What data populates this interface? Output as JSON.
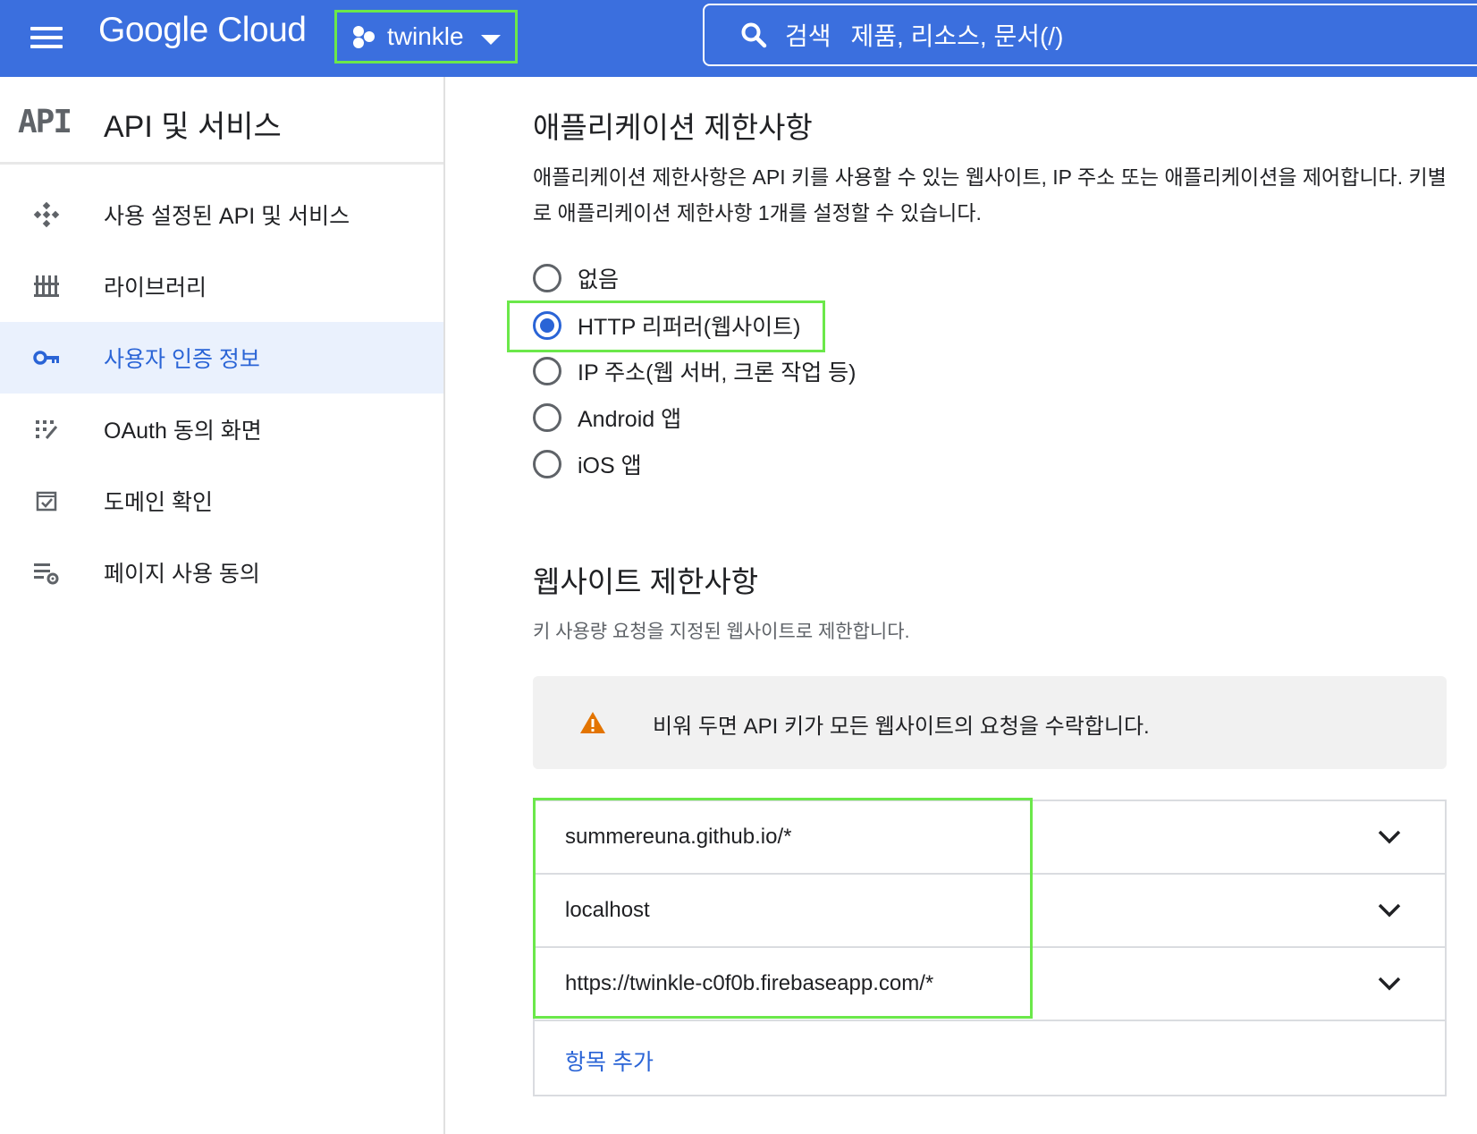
{
  "topbar": {
    "logo": "Google Cloud",
    "project": "twinkle",
    "search_label": "검색",
    "search_hint": "제품, 리소스, 문서(/)"
  },
  "sidebar": {
    "api_logo": "API",
    "title": "API 및 서비스",
    "items": [
      {
        "label": "사용 설정된 API 및 서비스",
        "icon": "api-hub-icon"
      },
      {
        "label": "라이브러리",
        "icon": "library-icon"
      },
      {
        "label": "사용자 인증 정보",
        "icon": "key-icon",
        "active": true
      },
      {
        "label": "OAuth 동의 화면",
        "icon": "oauth-consent-icon"
      },
      {
        "label": "도메인 확인",
        "icon": "domain-verify-icon"
      },
      {
        "label": "페이지 사용 동의",
        "icon": "page-settings-icon"
      }
    ]
  },
  "app_restrictions": {
    "title": "애플리케이션 제한사항",
    "description": "애플리케이션 제한사항은 API 키를 사용할 수 있는 웹사이트, IP 주소 또는 애플리케이션을 제어합니다. 키별로 애플리케이션 제한사항 1개를 설정할 수 있습니다.",
    "options": [
      {
        "label": "없음",
        "checked": false
      },
      {
        "label": "HTTP 리퍼러(웹사이트)",
        "checked": true
      },
      {
        "label": "IP 주소(웹 서버, 크론 작업 등)",
        "checked": false
      },
      {
        "label": "Android 앱",
        "checked": false
      },
      {
        "label": "iOS 앱",
        "checked": false
      }
    ]
  },
  "website_restrictions": {
    "title": "웹사이트 제한사항",
    "description": "키 사용량 요청을 지정된 웹사이트로 제한합니다.",
    "warning": "비워 두면 API 키가 모든 웹사이트의 요청을 수락합니다.",
    "items": [
      "summereuna.github.io/*",
      "localhost",
      "https://twinkle-c0f0b.firebaseapp.com/*"
    ],
    "add_item": "항목 추가"
  },
  "colors": {
    "topbar": "#3b6fde",
    "accent": "#2a64d6",
    "highlight": "#6be84a",
    "warning_icon": "#e37400"
  }
}
